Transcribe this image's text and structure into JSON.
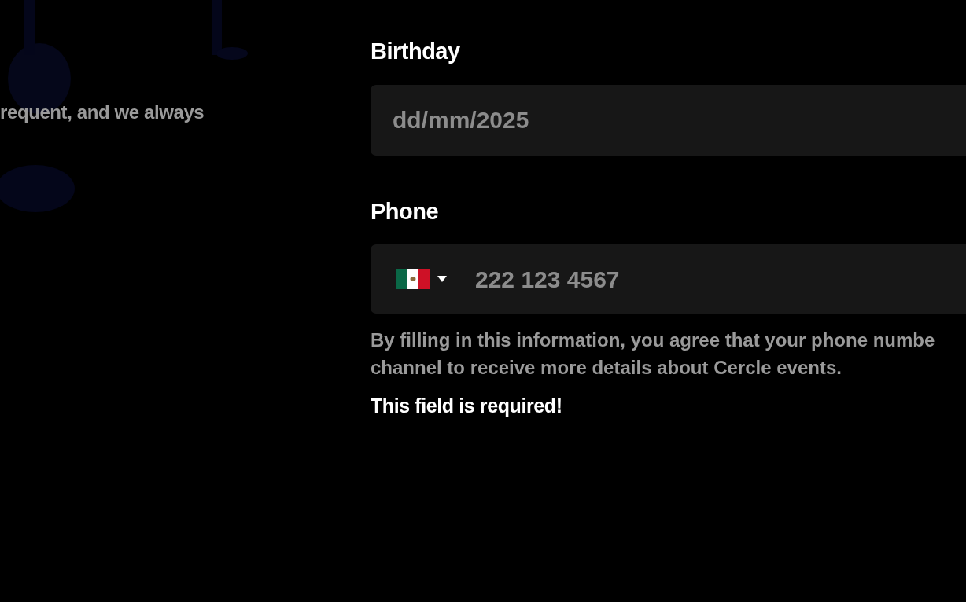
{
  "intro": {
    "text": "requent, and we always"
  },
  "fields": [
    {
      "kind": "date",
      "label": "Birthday",
      "placeholder": "dd/mm/2025"
    },
    {
      "kind": "phone",
      "label": "Phone",
      "placeholder": "222 123 4567",
      "hint": [
        "By filling in this information, you agree that your phone numbe",
        "channel to receive more details about Cercle events."
      ],
      "error": "This field is required!"
    }
  ]
}
